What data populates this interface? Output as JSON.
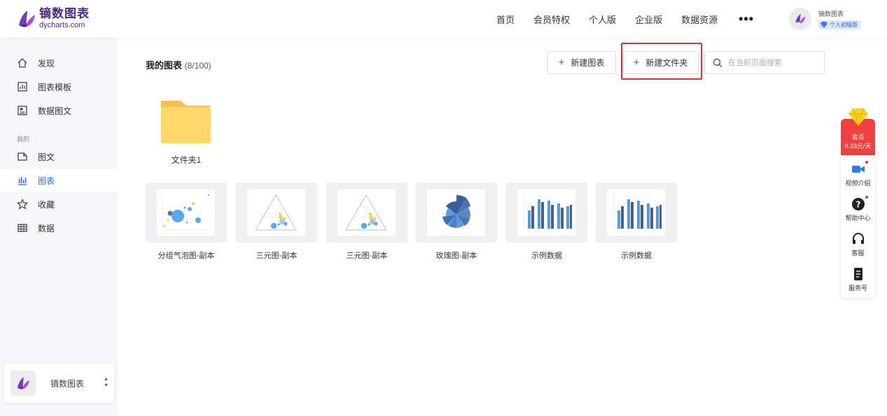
{
  "header": {
    "logo_name": "镝数图表",
    "logo_domain": "dycharts.com",
    "nav": [
      "首页",
      "会员特权",
      "个人版",
      "企业版",
      "数据资源"
    ],
    "more": "•••",
    "user_name": "镝数图表",
    "user_badge": "个人初级版"
  },
  "sidebar": {
    "items_top": [
      {
        "label": "发现",
        "icon": "home-icon"
      },
      {
        "label": "图表模板",
        "icon": "chart-template-icon"
      },
      {
        "label": "数据图文",
        "icon": "data-article-icon"
      }
    ],
    "group_label": "我的",
    "items_mine": [
      {
        "label": "图文",
        "icon": "article-icon"
      },
      {
        "label": "图表",
        "icon": "bar-chart-icon",
        "active": true
      },
      {
        "label": "收藏",
        "icon": "star-icon"
      },
      {
        "label": "数据",
        "icon": "table-icon"
      }
    ],
    "team_name": "镝数图表"
  },
  "main": {
    "title": "我的图表",
    "count": "(8/100)",
    "new_chart": "新建图表",
    "new_folder": "新建文件夹",
    "search_placeholder": "在当前页面搜索",
    "folder_name": "文件夹1",
    "charts": [
      {
        "label": "分组气泡图-副本",
        "kind": "bubble"
      },
      {
        "label": "三元图-副本",
        "kind": "ternary"
      },
      {
        "label": "三元图-副本",
        "kind": "ternary"
      },
      {
        "label": "玫瑰图-副本",
        "kind": "rose"
      },
      {
        "label": "示例数据",
        "kind": "bar"
      },
      {
        "label": "示例数据",
        "kind": "bar"
      }
    ]
  },
  "float": {
    "vip_line1": "会员",
    "vip_line2": "0.33元/天",
    "items": [
      "视频介绍",
      "帮助中心",
      "客服",
      "服务号"
    ]
  },
  "colors": {
    "accent": "#2f6bff",
    "vip": "#f04040",
    "highlight": "#e53030",
    "folder": "#ffd76a"
  }
}
